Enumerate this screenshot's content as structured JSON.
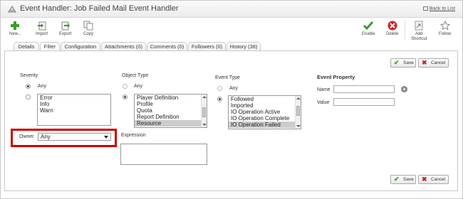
{
  "header": {
    "title": "Event Handler: Job Failed Mail Event Handler",
    "back_link": "Back to List"
  },
  "toolbar": {
    "new": "New...",
    "import": "Import",
    "export": "Export",
    "copy": "Copy",
    "enable": "Enable",
    "delete": "Delete",
    "add_shortcut_1": "Add",
    "add_shortcut_2": "Shortcut",
    "follow": "Follow"
  },
  "tabs": [
    {
      "label": "Details"
    },
    {
      "label": "Filter"
    },
    {
      "label": "Configuration"
    },
    {
      "label": "Attachments (0)"
    },
    {
      "label": "Comments (0)"
    },
    {
      "label": "Followers (0)"
    },
    {
      "label": "History (38)"
    }
  ],
  "buttons": {
    "save": "Save",
    "cancel": "Cancel"
  },
  "severity": {
    "label": "Severity",
    "any": "Any",
    "options": [
      "Error",
      "Info",
      "Warn"
    ]
  },
  "object_type": {
    "label": "Object Type",
    "any": "Any",
    "options": [
      "Player Definition",
      "Profile",
      "Quota",
      "Report Definition",
      "Resource"
    ],
    "selected": "Resource"
  },
  "event_type": {
    "label": "Event Type",
    "any": "Any",
    "options": [
      "Followed",
      "Imported",
      "IO Operation Active",
      "IO Operation Complete",
      "IO Operation Failed"
    ],
    "selected": "IO Operation Failed"
  },
  "event_property": {
    "label": "Event Property",
    "name_label": "Name",
    "value_label": "Value",
    "name_value": "",
    "value_value": ""
  },
  "owner": {
    "label": "Owner",
    "value": "Any"
  },
  "expression": {
    "label": "Expression",
    "value": ""
  }
}
